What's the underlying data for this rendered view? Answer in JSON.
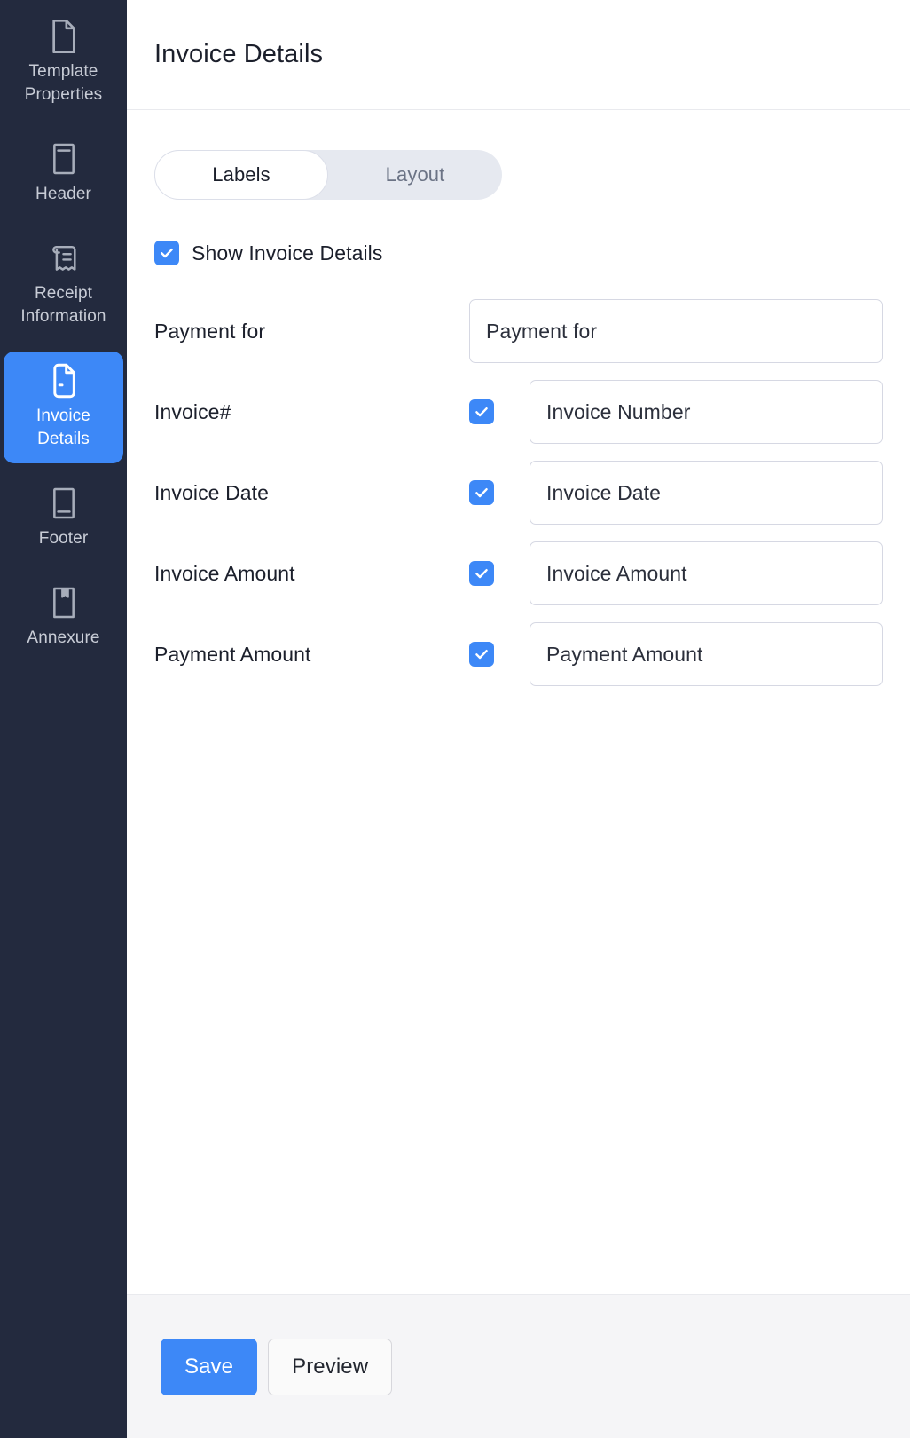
{
  "sidebar": {
    "items": [
      {
        "id": "template-properties",
        "label": "Template Properties",
        "icon": "document-icon",
        "active": false
      },
      {
        "id": "header",
        "label": "Header",
        "icon": "header-box-icon",
        "active": false
      },
      {
        "id": "receipt-information",
        "label": "Receipt Information",
        "icon": "receipt-icon",
        "active": false
      },
      {
        "id": "invoice-details",
        "label": "Invoice Details",
        "icon": "invoice-document-icon",
        "active": true
      },
      {
        "id": "footer",
        "label": "Footer",
        "icon": "footer-box-icon",
        "active": false
      },
      {
        "id": "annexure",
        "label": "Annexure",
        "icon": "bookmark-page-icon",
        "active": false
      }
    ]
  },
  "header": {
    "title": "Invoice Details"
  },
  "tabs": [
    {
      "id": "labels",
      "label": "Labels",
      "active": true
    },
    {
      "id": "layout",
      "label": "Layout",
      "active": false
    }
  ],
  "show_section": {
    "label": "Show Invoice Details",
    "checked": true,
    "checkbox_icon": "checkmark-icon"
  },
  "fields": [
    {
      "id": "payment-for",
      "label": "Payment for",
      "has_checkbox": false,
      "checked": false,
      "value": "Payment for",
      "placeholder": "Payment for"
    },
    {
      "id": "invoice-number",
      "label": "Invoice#",
      "has_checkbox": true,
      "checked": true,
      "value": "Invoice Number",
      "placeholder": "Invoice Number"
    },
    {
      "id": "invoice-date",
      "label": "Invoice Date",
      "has_checkbox": true,
      "checked": true,
      "value": "Invoice Date",
      "placeholder": "Invoice Date"
    },
    {
      "id": "invoice-amount",
      "label": "Invoice Amount",
      "has_checkbox": true,
      "checked": true,
      "value": "Invoice Amount",
      "placeholder": "Invoice Amount"
    },
    {
      "id": "payment-amount",
      "label": "Payment Amount",
      "has_checkbox": true,
      "checked": true,
      "value": "Payment Amount",
      "placeholder": "Payment Amount"
    }
  ],
  "footer": {
    "save_label": "Save",
    "preview_label": "Preview"
  },
  "colors": {
    "accent": "#3d88f7",
    "sidebar_bg": "#232a3e",
    "tab_group_bg": "#e6e9f0",
    "footer_bg": "#f5f5f7",
    "field_border": "#d6d8e3",
    "text_primary": "#1b1f2b",
    "text_muted": "#6b7385"
  }
}
